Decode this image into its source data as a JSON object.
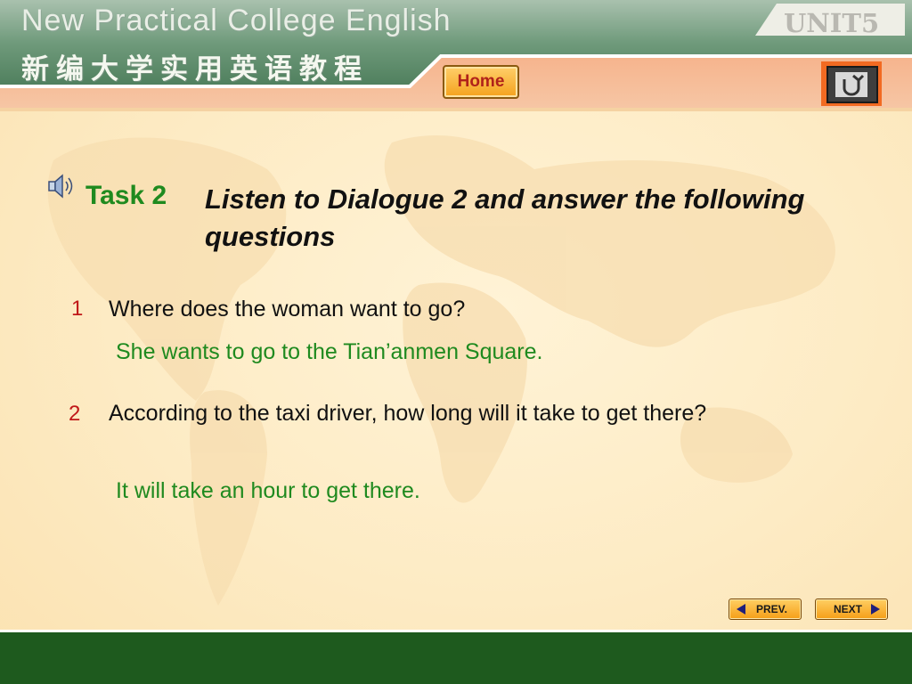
{
  "header": {
    "title": "New Practical College English",
    "title_cn": "新编大学实用英语教程",
    "unit": "UNIT5",
    "home_label": "Home",
    "back_icon": "return-icon"
  },
  "task": {
    "label": "Task 2",
    "title": "Listen to Dialogue 2 and answer the following questions",
    "speaker_icon": "speaker-icon"
  },
  "questions": [
    {
      "number": "1",
      "text": "Where does the woman want to go?",
      "answer": "She wants to go to the Tian’anmen Square."
    },
    {
      "number": "2",
      "text": "According to the taxi driver, how long will it take to get there?",
      "answer": "It will take an hour to get there."
    }
  ],
  "nav": {
    "prev_label": "PREV.",
    "next_label": "NEXT"
  },
  "colors": {
    "accent_green": "#1f8a1f",
    "number_red": "#c01818",
    "header_green": "#5f8a6c",
    "header_orange": "#f07a3a",
    "footer_green": "#1e5a1e"
  }
}
